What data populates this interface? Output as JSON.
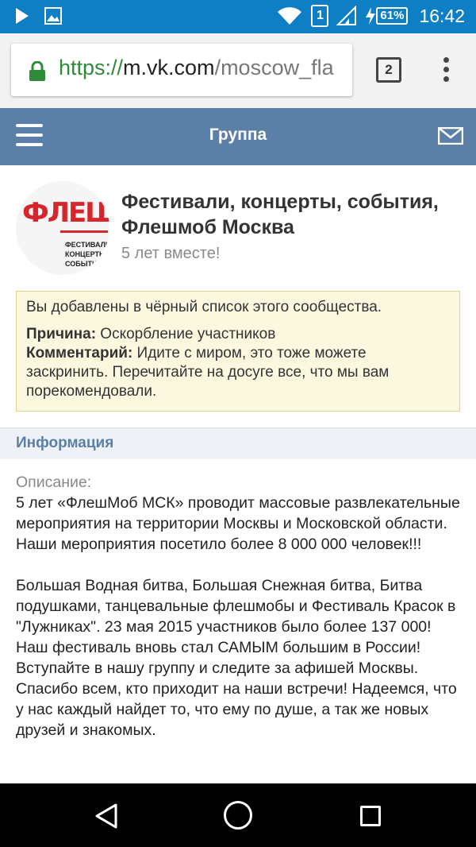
{
  "statusbar": {
    "sim": "1",
    "battery": "61%",
    "time": "16:42"
  },
  "browser": {
    "url_scheme": "https://",
    "url_host": "m.vk.com",
    "url_path": "/moscow_fla",
    "tab_count": "2"
  },
  "header": {
    "title": "Группа"
  },
  "group": {
    "avatar_logo": "ФЛЕШМОБ",
    "avatar_lines": [
      "ФЕСТИВАЛИ",
      "КОНЦЕРТЫ",
      "СОБЫТИ"
    ],
    "name": "Фестивали, концерты, события, Флешмоб Москва",
    "status": "5 лет вместе!"
  },
  "blacklist": {
    "message": "Вы добавлены в чёрный список этого сообщества.",
    "reason_label": "Причина:",
    "reason_value": " Оскорбление участников",
    "comment_label": "Комментарий:",
    "comment_value": " Идите с миром, это тоже можете заскринить. Перечитайте на досуге все, что мы вам порекомендовали."
  },
  "info": {
    "section_title": "Информация",
    "desc_label": "Описание:",
    "desc_text": "5 лет «ФлешМоб МСК» проводит массовые развлекательные мероприятия на территории Москвы и Московской области. Наши мероприятия посетило более 8 000 000 человек!!!\n\nБольшая Водная битва, Большая Снежная битва, Битва подушками, танцевальные флешмобы и Фестиваль Красок в \"Лужниках\". 23 мая 2015 участников было более 137 000! Наш фестиваль вновь стал САМЫМ большим в России!\nВступайте в нашу группу и следите за афишей Москвы. Спасибо всем, кто приходит на наши встречи! Надеемся, что у нас каждый найдет то, что ему по душе, а так же новых друзей и знакомых."
  }
}
